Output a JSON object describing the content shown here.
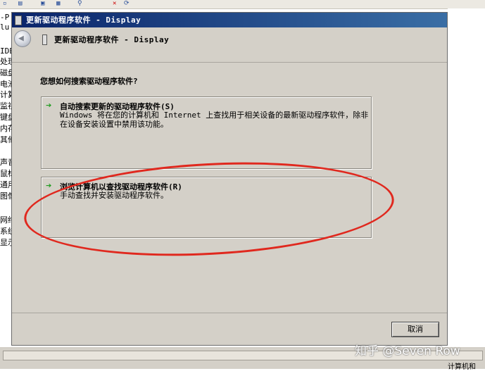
{
  "background": {
    "tree_items": [
      "-P",
      "lu",
      "",
      "IDE",
      "处理",
      "磁盘",
      "电池",
      "计算",
      "监视",
      "键盘",
      "内存",
      "其他",
      "",
      "声音",
      "鼠标",
      "通用",
      "图像",
      "",
      "网络",
      "系统",
      "显示"
    ],
    "status_bar_text": "计算机和"
  },
  "wizard": {
    "window_title": "更新驱动程序软件 - Display",
    "header_title": "更新驱动程序软件 - Display",
    "question": "您想如何搜索驱动程序软件?",
    "options": [
      {
        "title": "自动搜索更新的驱动程序软件(S)",
        "description": "Windows 将在您的计算机和 Internet 上查找用于相关设备的最新驱动程序软件，除非在设备安装设置中禁用该功能。"
      },
      {
        "title": "浏览计算机以查找驱动程序软件(R)",
        "description": "手动查找并安装驱动程序软件。"
      }
    ],
    "cancel_label": "取消"
  },
  "watermark": "知乎 @Seven Row",
  "colors": {
    "title_bar": "#0a246a",
    "dialog_face": "#d4d0c8",
    "annotation": "#e0281e",
    "arrow": "#1b9a1b"
  },
  "icons": {
    "back": "back-arrow-icon",
    "option_arrow": "green-arrow-icon"
  }
}
